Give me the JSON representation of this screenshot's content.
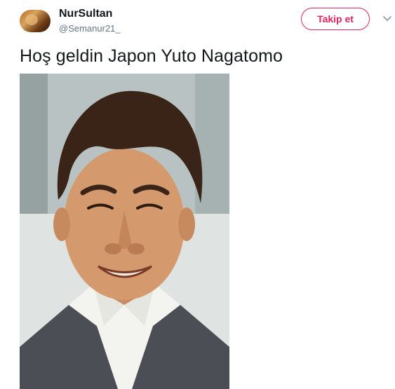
{
  "author": {
    "name": "NurSultan",
    "handle": "@Semanur21_"
  },
  "follow_button_label": "Takip et",
  "tweet": {
    "text": "Hoş geldin Japon Yuto Nagatomo"
  },
  "colors": {
    "accent": "#e0245e",
    "text": "#14171a",
    "muted": "#657786"
  },
  "icons": {
    "menu": "chevron-down-icon"
  }
}
